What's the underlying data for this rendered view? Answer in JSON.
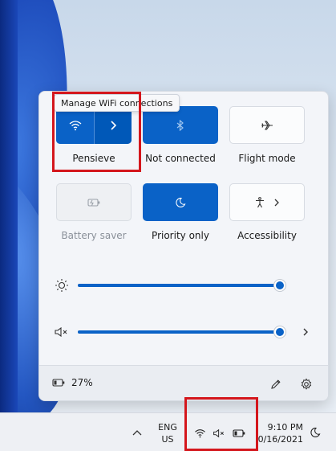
{
  "tooltip": "Manage WiFi connections",
  "tiles": {
    "wifi": {
      "label": "Pensieve",
      "state": "on"
    },
    "bluetooth": {
      "label": "Not connected",
      "state": "on"
    },
    "flight_mode": {
      "label": "Flight mode",
      "state": "off"
    },
    "battery_saver": {
      "label": "Battery saver",
      "state": "disabled"
    },
    "focus_assist": {
      "label": "Priority only",
      "state": "on"
    },
    "accessibility": {
      "label": "Accessibility",
      "state": "off"
    }
  },
  "sliders": {
    "brightness": {
      "value": 1.0
    },
    "volume": {
      "value": 1.0
    }
  },
  "footer": {
    "battery_text": "27%"
  },
  "taskbar": {
    "lang_primary": "ENG",
    "lang_secondary": "US",
    "time": "9:10 PM",
    "date": "0/16/2021"
  },
  "colors": {
    "accent": "#0a62c7",
    "highlight": "#d4161c"
  }
}
